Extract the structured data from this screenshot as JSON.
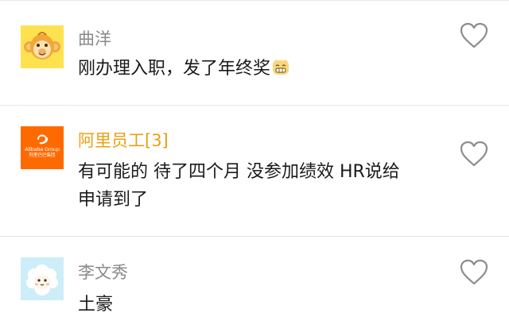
{
  "comments": [
    {
      "username": "曲洋",
      "text": "刚办理入职，发了年终奖",
      "avatar_icon": "monkey-icon",
      "emoji_icon": "grin-emoji-icon"
    },
    {
      "username": "阿里员工[3]",
      "text_line1": "有可能的 待了四个月 没参加绩效 HR说给",
      "text_line2": "申请到了",
      "avatar_icon": "alibaba-logo-icon",
      "avatar_logo": "Alibaba Group",
      "avatar_logo_cn": "阿里巴巴集团"
    },
    {
      "username": "李文秀",
      "text": "土豪",
      "avatar_icon": "sheep-icon"
    }
  ],
  "colors": {
    "name_default": "#8a8a8a",
    "name_highlight": "#e8a012",
    "text": "#1a1a1a",
    "divider": "#e6e6e6",
    "alibaba_orange": "#ff6a00",
    "heart_outline": "#8c8c8c"
  }
}
